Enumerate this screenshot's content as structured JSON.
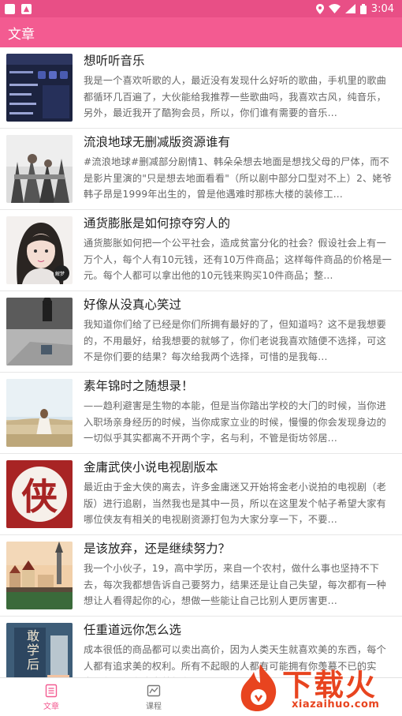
{
  "status_bar": {
    "time": "3:04"
  },
  "app_bar": {
    "title": "文章"
  },
  "articles": [
    {
      "title": "想听听音乐",
      "summary": "我是一个喜欢听歌的人，最近没有发现什么好听的歌曲，手机里的歌曲都循环几百遍了，大伙能给我推荐一些歌曲吗，我喜欢古风，纯音乐，另外，最近我开了酷狗会员，所以，你们谁有需要的音乐..."
    },
    {
      "title": "流浪地球无删减版资源谁有",
      "summary": "#流浪地球#删减部分剧情1、韩朵朵想去地面是想找父母的尸体，而不是影片里演的\"只是想去地面看看\"（所以剧中部分口型对不上）2、姥爷韩子昂是1999年出生的，曾是他遇难时那栋大楼的装修工..."
    },
    {
      "title": "通货膨胀是如何掠夺穷人的",
      "summary": "通货膨胀如何把一个公平社会，造成贫富分化的社会？假设社会上有一万个人，每个人有10元钱，还有10万件商品；这样每件商品的价格是一元。每个人都可以拿出他的10元钱来购买10件商品；整..."
    },
    {
      "title": "好像从没真心笑过",
      "summary": "我知道你们给了已经是你们所拥有最好的了，但知道吗？这不是我想要的，不用最好，给我想要的就够了，你们老说我喜欢随便不选择，可这不是你们要的结果？每次给我两个选择，可惜的是我每..."
    },
    {
      "title": "素年锦时之随想录！",
      "summary": "——趋利避害是生物的本能，但是当你踏出学校的大门的时候，当你进入职场亲身经历的时候，当你成家立业的时候，慢慢的你会发现身边的一切似乎其实都离不开两个字，名与利，不管是街坊邻居..."
    },
    {
      "title": "金庸武侠小说电视剧版本",
      "summary": "最近由于金大侠的离去，许多金庸迷又开始将金老小说拍的电视剧（老版）进行追剧，当然我也是其中一员，所以在这里发个帖子希望大家有哪位侠友有相关的电视剧资源打包为大家分享一下，不要..."
    },
    {
      "title": "是该放弃，还是继续努力？",
      "summary": "我一个小伙子，19，高中学历，来自一个农村，做什么事也坚持不下去，每次我都想告诉自己要努力，结果还是让自己失望，每次都有一种想让人看得起你的心，想做一些能让自己比别人更厉害更..."
    },
    {
      "title": "任重道远你怎么选",
      "summary": "成本很低的商品都可以卖出高价，因为人类天生就喜欢美的东西，每个人都有追求美的权利。所有不起眼的人都有可能拥有你羡慕不已的实力，但是没有实力就得有一..."
    }
  ],
  "thumb_text": {
    "jiemeng": "解梦",
    "xia": "侠",
    "xuehou": "敢学后"
  },
  "bottom_nav": [
    {
      "label": "文章"
    },
    {
      "label": "课程"
    }
  ],
  "watermark": {
    "brand": "下载火",
    "url": "xiazaihuo.com"
  },
  "colors": {
    "primary": "#f35b91",
    "status_bar": "#e84f86",
    "watermark": "#e8441f"
  }
}
